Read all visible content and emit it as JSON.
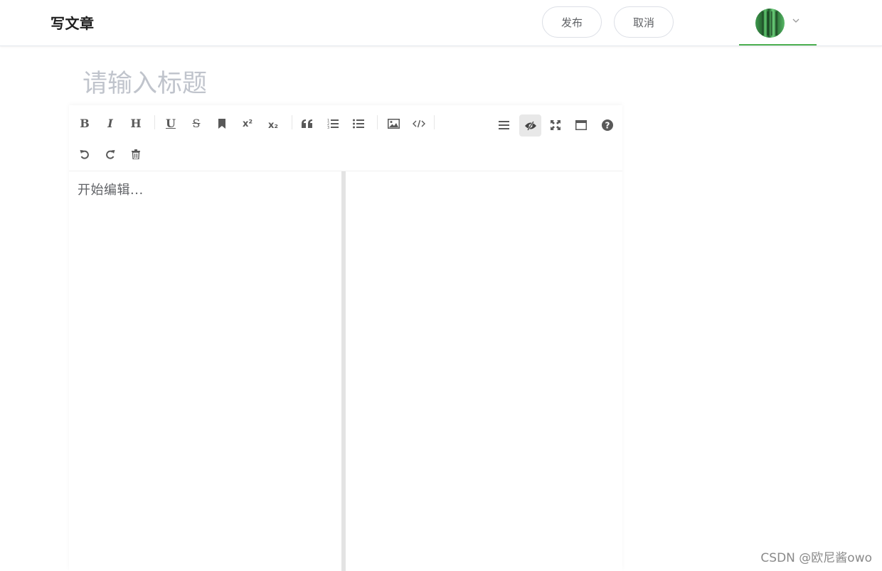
{
  "header": {
    "app_title": "写文章",
    "publish_label": "发布",
    "cancel_label": "取消",
    "user": {
      "avatar_icon": "avatar-image",
      "menu_icon": "chevron-down-icon"
    },
    "accent_color": "#4caf50"
  },
  "title": {
    "placeholder": "请输入标题",
    "value": ""
  },
  "editor": {
    "toolbar_left": [
      {
        "name": "bold",
        "glyph": "B"
      },
      {
        "name": "italic",
        "glyph": "I"
      },
      {
        "name": "heading",
        "glyph": "H"
      },
      {
        "name": "underline",
        "glyph": "U"
      },
      {
        "name": "strikethrough",
        "glyph": "S"
      },
      {
        "name": "mark-bookmark",
        "icon": "bookmark-icon"
      },
      {
        "name": "superscript",
        "glyph": "x²"
      },
      {
        "name": "subscript",
        "glyph": "x₂"
      },
      {
        "name": "quote",
        "icon": "quote-icon"
      },
      {
        "name": "ordered-list",
        "icon": "ordered-list-icon"
      },
      {
        "name": "unordered-list",
        "icon": "unordered-list-icon"
      },
      {
        "name": "image",
        "icon": "image-icon"
      },
      {
        "name": "code",
        "icon": "code-icon"
      },
      {
        "name": "undo",
        "icon": "undo-icon"
      },
      {
        "name": "redo",
        "icon": "redo-icon"
      },
      {
        "name": "trash",
        "icon": "trash-icon"
      }
    ],
    "toolbar_right": [
      {
        "name": "navigation",
        "icon": "menu-icon"
      },
      {
        "name": "preview-toggle",
        "icon": "eye-slash-icon",
        "active": true
      },
      {
        "name": "fullscreen",
        "icon": "expand-icon"
      },
      {
        "name": "window",
        "icon": "window-icon"
      },
      {
        "name": "help",
        "icon": "question-circle-icon"
      }
    ],
    "placeholder": "开始编辑...",
    "content": ""
  },
  "watermark": "CSDN @欧尼酱owo"
}
